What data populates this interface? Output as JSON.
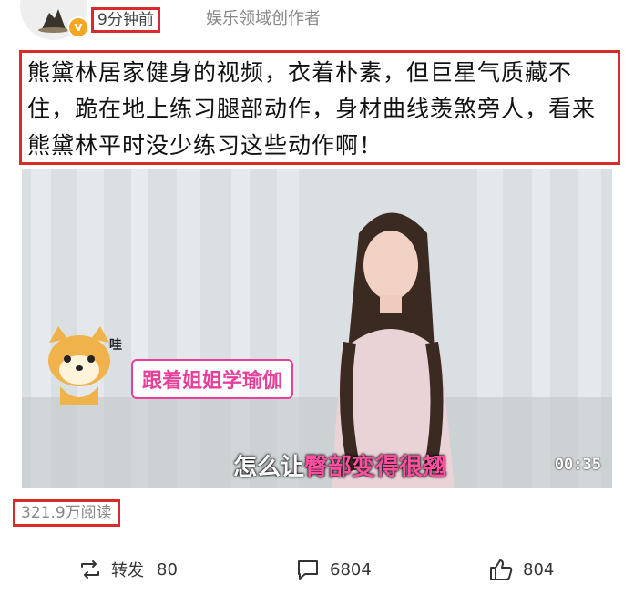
{
  "post": {
    "time": "9分钟前",
    "author_tag": "娱乐领域创作者",
    "text": "熊黛林居家健身的视频，衣着朴素，但巨星气质藏不住，跪在地上练习腿部动作，身材曲线羡煞旁人，看来熊黛林平时没少练习这些动作啊！",
    "reads": "321.9万阅读"
  },
  "video": {
    "sticker_text": "跟着姐姐学瑜伽",
    "sticker_exclaim": "哇",
    "subtitle_prefix": "怎么让",
    "subtitle_highlight": "臀部变得很翘",
    "duration": "00:35"
  },
  "actions": {
    "repost_label": "转发",
    "repost_count": "80",
    "comment_count": "6804",
    "like_count": "804"
  },
  "icons": {
    "repost": "repost-icon",
    "comment": "comment-icon",
    "like": "like-icon",
    "verified": "verified-badge-icon"
  },
  "colors": {
    "highlight_box": "#d92b2b",
    "verified": "#f5a623",
    "subtitle_highlight": "#ff4fa0"
  }
}
